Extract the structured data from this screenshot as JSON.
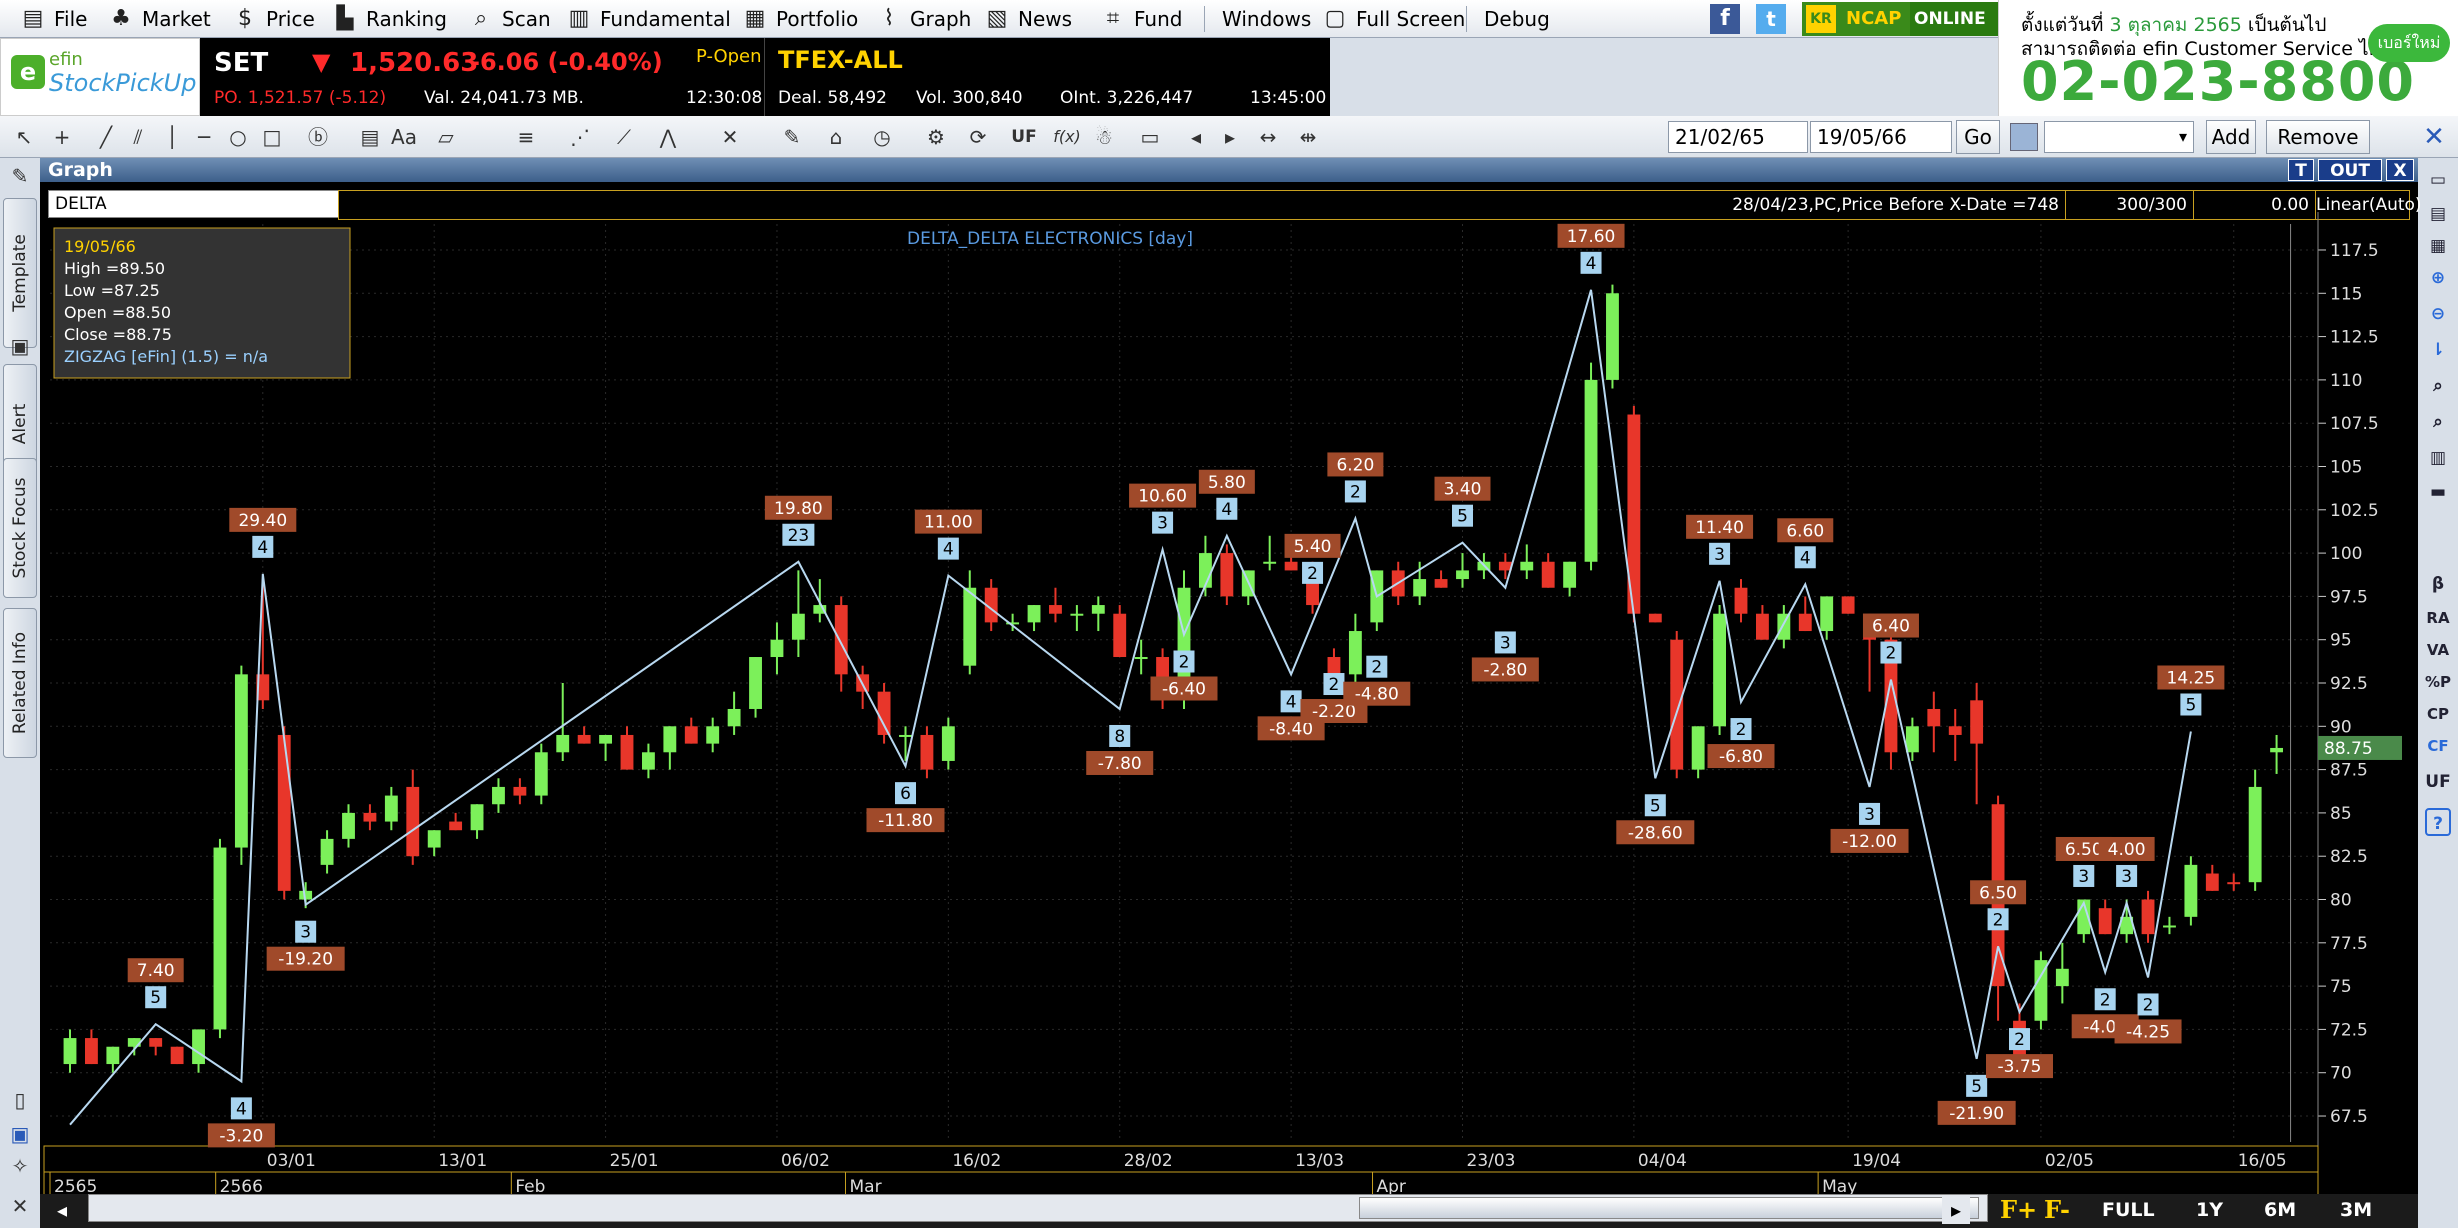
{
  "menu": {
    "items": [
      {
        "label": "File",
        "icon": "file-icon"
      },
      {
        "label": "Market",
        "icon": "market-icon"
      },
      {
        "label": "Price",
        "icon": "dollar-icon"
      },
      {
        "label": "Ranking",
        "icon": "ranking-icon"
      },
      {
        "label": "Scan",
        "icon": "scan-icon"
      },
      {
        "label": "Fundamental",
        "icon": "fundamental-icon"
      },
      {
        "label": "Portfolio",
        "icon": "portfolio-icon"
      },
      {
        "label": "Graph",
        "icon": "graph-icon"
      },
      {
        "label": "News",
        "icon": "news-icon"
      },
      {
        "label": "Fund",
        "icon": "fund-icon"
      },
      {
        "label": "Windows",
        "icon": ""
      },
      {
        "label": "Full Screen",
        "icon": "fullscreen-icon"
      },
      {
        "label": "Debug",
        "icon": ""
      }
    ],
    "broker": "NCAP",
    "status": "ONLINE"
  },
  "banner": {
    "line1_prefix": "ตั้งแต่วันที่",
    "line1_date": "3 ตุลาคม 2565",
    "line1_suffix": "เป็นต้นไป",
    "line2": "สามารถติดต่อ efin Customer Service ได้ที่",
    "phone": "02-023-8800",
    "badge": "เบอร์ใหม่"
  },
  "logo": {
    "top": "efin",
    "bottom": "StockPickUp"
  },
  "quote": {
    "index": "SET",
    "value": "1,520.63",
    "change": "-6.06 (-0.40%)",
    "session": "P-Open",
    "po": "PO. 1,521.57 (-5.12)",
    "val": "Val. 24,041.73 MB.",
    "time1": "12:30:08",
    "tfex": "TFEX-ALL",
    "deal": "Deal. 58,492",
    "vol": "Vol. 300,840",
    "oint": "OInt. 3,226,447",
    "time2": "13:45:00"
  },
  "toolbar": {
    "date_from": "21/02/65",
    "date_to": "19/05/66",
    "go": "Go",
    "add": "Add",
    "remove": "Remove",
    "uf": "UF",
    "fx": "f(x)"
  },
  "window": {
    "title": "Graph",
    "btn_t": "T",
    "btn_out": "OUT",
    "btn_x": "X"
  },
  "left_tabs": [
    "Template",
    "Alert",
    "Stock Focus",
    "Related Info"
  ],
  "right_tools": [
    "β",
    "RA",
    "VA",
    "%P",
    "CP",
    "CF",
    "UF",
    "?"
  ],
  "chart_info": {
    "symbol": "DELTA",
    "xdate": "28/04/23,PC,Price Before X-Date =748",
    "count": "300/300",
    "zero": "0.00",
    "scale": "Linear(Auto)"
  },
  "chart_data": {
    "type": "candlestick",
    "title": "DELTA_DELTA ELECTRONICS [day]",
    "price_marker": "88.75",
    "ylim": [
      66,
      119
    ],
    "yticks": [
      "117.5",
      "115",
      "112.5",
      "110",
      "107.5",
      "105",
      "102.5",
      "100",
      "97.5",
      "95",
      "92.5",
      "90",
      "87.5",
      "85",
      "82.5",
      "80",
      "77.5",
      "75",
      "72.5",
      "70",
      "67.5"
    ],
    "xticks": [
      "03/01",
      "13/01",
      "25/01",
      "06/02",
      "16/02",
      "28/02",
      "13/03",
      "23/03",
      "04/04",
      "19/04",
      "02/05",
      "16/05"
    ],
    "periods": [
      "2565",
      "2566",
      "Feb",
      "Mar",
      "Apr",
      "May"
    ],
    "tooltip": {
      "date": "19/05/66",
      "high": "High  =89.50",
      "low": "Low   =87.25",
      "open": "Open  =88.50",
      "close": "Close =88.75",
      "indicator": "ZIGZAG [eFin] (1.5)   = n/a"
    },
    "candles": [
      [
        70.5,
        72.5,
        70,
        72,
        1
      ],
      [
        72,
        72.5,
        70.5,
        70.5,
        0
      ],
      [
        70.5,
        71.5,
        70,
        71.5,
        1
      ],
      [
        71.5,
        72,
        71,
        72,
        1
      ],
      [
        72,
        72,
        71,
        71.5,
        0
      ],
      [
        71.5,
        71.5,
        70.5,
        70.5,
        0
      ],
      [
        70.5,
        72.5,
        70,
        72.5,
        1
      ],
      [
        72.5,
        83.5,
        72,
        83,
        1
      ],
      [
        83,
        93.5,
        82,
        93,
        1
      ],
      [
        93,
        98.5,
        91,
        91.5,
        0
      ],
      [
        89.5,
        90,
        80,
        80.5,
        0
      ],
      [
        80.5,
        81,
        79.5,
        80,
        1
      ],
      [
        82,
        84,
        81.5,
        83.5,
        1
      ],
      [
        83.5,
        85.5,
        83,
        85,
        1
      ],
      [
        85,
        85.5,
        84,
        84.5,
        0
      ],
      [
        84.5,
        86.5,
        84,
        86,
        1
      ],
      [
        86.5,
        87.5,
        82,
        82.5,
        0
      ],
      [
        83,
        84,
        82.5,
        84,
        1
      ],
      [
        84.5,
        85,
        84,
        84,
        0
      ],
      [
        84,
        85.5,
        83.5,
        85.5,
        1
      ],
      [
        85.5,
        87,
        85,
        86.5,
        1
      ],
      [
        86.5,
        87,
        85.5,
        86,
        0
      ],
      [
        86,
        89,
        85.5,
        88.5,
        1
      ],
      [
        88.5,
        92.5,
        88,
        89.5,
        1
      ],
      [
        89.5,
        90,
        89,
        89,
        0
      ],
      [
        89,
        89.5,
        88,
        89.5,
        1
      ],
      [
        89.5,
        90,
        87.5,
        87.5,
        0
      ],
      [
        87.5,
        89,
        87,
        88.5,
        1
      ],
      [
        88.5,
        90,
        87.5,
        90,
        1
      ],
      [
        90,
        90.5,
        89,
        89,
        0
      ],
      [
        89,
        90.5,
        88.5,
        90,
        1
      ],
      [
        90,
        92,
        89.5,
        91,
        1
      ],
      [
        91,
        94,
        90.5,
        94,
        1
      ],
      [
        94,
        96,
        93,
        95,
        1
      ],
      [
        95,
        99,
        94,
        96.5,
        1
      ],
      [
        96.5,
        98.5,
        96,
        97,
        1
      ],
      [
        97,
        97.5,
        92,
        93,
        0
      ],
      [
        93,
        93.5,
        91,
        92,
        0
      ],
      [
        92,
        92.5,
        89,
        89.5,
        0
      ],
      [
        89.5,
        90,
        88,
        89.5,
        1
      ],
      [
        89.5,
        90,
        87,
        87.5,
        0
      ],
      [
        88,
        90.5,
        87.5,
        90,
        1
      ],
      [
        93.5,
        99,
        93,
        98,
        1
      ],
      [
        98,
        98.5,
        95.5,
        96,
        0
      ],
      [
        96,
        96.5,
        95.5,
        96,
        1
      ],
      [
        96,
        97,
        95.5,
        97,
        1
      ],
      [
        97,
        98,
        96,
        96.5,
        0
      ],
      [
        96.5,
        97,
        95.5,
        96.5,
        1
      ],
      [
        96.5,
        97.5,
        95.5,
        97,
        1
      ],
      [
        96.5,
        97,
        94,
        94,
        0
      ],
      [
        94,
        95,
        93,
        94,
        1
      ],
      [
        94,
        94.5,
        91,
        91.5,
        0
      ],
      [
        91.5,
        99,
        91,
        98,
        1
      ],
      [
        98,
        101,
        97.5,
        100,
        1
      ],
      [
        100,
        100.5,
        97,
        97.5,
        0
      ],
      [
        97.5,
        99,
        97,
        99,
        1
      ],
      [
        99.5,
        101,
        99,
        99.5,
        1
      ],
      [
        99.5,
        100,
        99,
        99,
        0
      ],
      [
        99,
        99.5,
        96.5,
        97,
        0
      ],
      [
        94,
        94.5,
        93,
        93,
        0
      ],
      [
        93,
        96.5,
        92.5,
        95.5,
        1
      ],
      [
        96,
        99,
        95.5,
        99,
        1
      ],
      [
        99,
        99.5,
        97,
        97.5,
        0
      ],
      [
        97.5,
        99.5,
        97,
        98.5,
        1
      ],
      [
        98.5,
        99,
        98,
        98,
        0
      ],
      [
        98.5,
        100,
        98,
        99,
        1
      ],
      [
        99,
        100,
        98.5,
        99.5,
        1
      ],
      [
        99.5,
        100,
        98.5,
        99,
        0
      ],
      [
        99,
        100.5,
        98.5,
        99.5,
        1
      ],
      [
        99.5,
        100,
        98,
        98,
        0
      ],
      [
        98,
        99.5,
        97.5,
        99.5,
        1
      ],
      [
        99.5,
        111,
        99,
        110,
        1
      ],
      [
        110,
        115.5,
        109.5,
        115,
        1
      ],
      [
        108,
        108.5,
        96,
        96.5,
        0
      ],
      [
        96.5,
        96.5,
        96,
        96,
        0
      ],
      [
        95,
        95.5,
        87,
        87.5,
        0
      ],
      [
        87.5,
        90,
        87,
        90,
        1
      ],
      [
        90,
        97,
        89.5,
        96.5,
        1
      ],
      [
        98,
        98.5,
        96,
        96.5,
        0
      ],
      [
        96.5,
        97,
        95,
        95,
        0
      ],
      [
        95,
        97,
        94.5,
        96.5,
        1
      ],
      [
        96.5,
        97.5,
        95.5,
        95.5,
        0
      ],
      [
        95.5,
        97.5,
        95,
        97.5,
        1
      ],
      [
        97.5,
        97.5,
        96.5,
        96.5,
        0
      ],
      [
        96,
        96.5,
        92,
        95,
        0
      ],
      [
        95,
        95.5,
        87.5,
        88.5,
        0
      ],
      [
        88.5,
        90.5,
        88,
        90,
        1
      ],
      [
        91,
        92,
        88.5,
        90,
        0
      ],
      [
        90,
        91,
        88,
        89.5,
        0
      ],
      [
        91.5,
        92.5,
        85.5,
        89,
        0
      ],
      [
        85.5,
        86,
        73,
        75,
        0
      ],
      [
        73,
        74,
        70.5,
        71,
        0
      ],
      [
        73,
        77,
        72.5,
        76.5,
        1
      ],
      [
        75,
        77.5,
        74,
        76,
        1
      ],
      [
        78,
        80,
        77.5,
        80,
        1
      ],
      [
        79.5,
        80,
        78,
        78,
        0
      ],
      [
        78,
        80,
        77.5,
        79,
        1
      ],
      [
        80,
        80.5,
        77.5,
        78,
        0
      ],
      [
        78.5,
        79,
        78,
        78.5,
        1
      ],
      [
        79,
        82.5,
        78.5,
        82,
        1
      ],
      [
        81.5,
        82,
        80.5,
        80.5,
        0
      ],
      [
        81,
        81.5,
        80.5,
        81,
        0
      ],
      [
        81,
        87.5,
        80.5,
        86.5,
        1
      ],
      [
        88.5,
        89.5,
        87.25,
        88.75,
        1
      ]
    ],
    "zigzag_points": [
      [
        0,
        67
      ],
      [
        4,
        72.8
      ],
      [
        8,
        69.5
      ],
      [
        9,
        98.8
      ],
      [
        11,
        79.7
      ],
      [
        34,
        99.5
      ],
      [
        39,
        87.7
      ],
      [
        41,
        98.7
      ],
      [
        49,
        91
      ],
      [
        51,
        100.2
      ],
      [
        52,
        95.3
      ],
      [
        54,
        101
      ],
      [
        57,
        93
      ],
      [
        60,
        102
      ],
      [
        61,
        97.5
      ],
      [
        65,
        100.6
      ],
      [
        67,
        98
      ],
      [
        71,
        115.2
      ],
      [
        74,
        87
      ],
      [
        77,
        98.4
      ],
      [
        78,
        91.4
      ],
      [
        81,
        98.2
      ],
      [
        84,
        86.5
      ],
      [
        85,
        92.7
      ],
      [
        89,
        70.8
      ],
      [
        90,
        77.3
      ],
      [
        91,
        73.5
      ],
      [
        94,
        79.8
      ],
      [
        95,
        75.8
      ],
      [
        96,
        79.8
      ],
      [
        97,
        75.5
      ],
      [
        99,
        89.7
      ]
    ],
    "annotations": [
      {
        "i": 4,
        "price": 72.8,
        "up": true,
        "n": "5",
        "v": "7.40"
      },
      {
        "i": 8,
        "price": 69.5,
        "up": false,
        "n": "4",
        "v": "-3.20"
      },
      {
        "i": 9,
        "price": 98.8,
        "up": true,
        "n": "4",
        "v": "29.40"
      },
      {
        "i": 11,
        "price": 79.7,
        "up": false,
        "n": "3",
        "v": "-19.20"
      },
      {
        "i": 34,
        "price": 99.5,
        "up": true,
        "n": "23",
        "v": "19.80"
      },
      {
        "i": 39,
        "price": 87.7,
        "up": false,
        "n": "6",
        "v": "-11.80"
      },
      {
        "i": 41,
        "price": 98.7,
        "up": true,
        "n": "4",
        "v": "11.00"
      },
      {
        "i": 49,
        "price": 91,
        "up": false,
        "n": "8",
        "v": "-7.80"
      },
      {
        "i": 51,
        "price": 100.2,
        "up": true,
        "n": "3",
        "v": "10.60"
      },
      {
        "i": 52,
        "price": 95.3,
        "up": false,
        "n": "2",
        "v": "-6.40"
      },
      {
        "i": 54,
        "price": 101,
        "up": true,
        "n": "4",
        "v": "5.80"
      },
      {
        "i": 57,
        "price": 93,
        "up": false,
        "n": "4",
        "v": "-8.40"
      },
      {
        "i": 58,
        "price": 97.3,
        "up": true,
        "n": "2",
        "v": "5.40"
      },
      {
        "i": 59,
        "price": 94,
        "up": false,
        "n": "2",
        "v": "-2.20"
      },
      {
        "i": 60,
        "price": 102,
        "up": true,
        "n": "2",
        "v": "6.20"
      },
      {
        "i": 61,
        "price": 95,
        "up": false,
        "n": "2",
        "v": "-4.80"
      },
      {
        "i": 65,
        "price": 100.6,
        "up": true,
        "n": "5",
        "v": "3.40"
      },
      {
        "i": 67,
        "price": 96.4,
        "up": false,
        "n": "3",
        "v": "-2.80"
      },
      {
        "i": 71,
        "price": 115.2,
        "up": true,
        "n": "4",
        "v": "17.60"
      },
      {
        "i": 74,
        "price": 87,
        "up": false,
        "n": "5",
        "v": "-28.60"
      },
      {
        "i": 77,
        "price": 98.4,
        "up": true,
        "n": "3",
        "v": "11.40"
      },
      {
        "i": 78,
        "price": 91.4,
        "up": false,
        "n": "2",
        "v": "-6.80"
      },
      {
        "i": 81,
        "price": 98.2,
        "up": true,
        "n": "4",
        "v": "6.60"
      },
      {
        "i": 84,
        "price": 86.5,
        "up": false,
        "n": "3",
        "v": "-12.00"
      },
      {
        "i": 85,
        "price": 92.7,
        "up": true,
        "n": "2",
        "v": "6.40"
      },
      {
        "i": 89,
        "price": 70.8,
        "up": false,
        "n": "5",
        "v": "-21.90"
      },
      {
        "i": 90,
        "price": 77.3,
        "up": true,
        "n": "2",
        "v": "6.50"
      },
      {
        "i": 91,
        "price": 73.5,
        "up": false,
        "n": "2",
        "v": "-3.75"
      },
      {
        "i": 94,
        "price": 79.8,
        "up": true,
        "n": "3",
        "v": "6.50"
      },
      {
        "i": 95,
        "price": 75.8,
        "up": false,
        "n": "2",
        "v": "-4.00"
      },
      {
        "i": 96,
        "price": 79.8,
        "up": true,
        "n": "3",
        "v": "4.00"
      },
      {
        "i": 97,
        "price": 75.5,
        "up": false,
        "n": "2",
        "v": "-4.25"
      },
      {
        "i": 99,
        "price": 89.7,
        "up": true,
        "n": "5",
        "v": "14.25"
      }
    ],
    "colors": {
      "up": "#7cf05a",
      "down": "#e8362a",
      "zigzag": "#b8d8f0",
      "label_bg": "#a04a2a",
      "count_bg": "#a8d4f0"
    }
  },
  "range_buttons": [
    "F+",
    "F-",
    "FULL",
    "1Y",
    "6M",
    "3M"
  ]
}
